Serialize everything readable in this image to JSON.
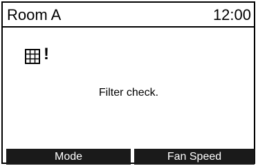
{
  "header": {
    "room_name": "Room A",
    "clock": "12:00"
  },
  "alert": {
    "icon": "filter-icon",
    "mark": "!",
    "message": "Filter check."
  },
  "softkeys": {
    "left_label": "Mode",
    "right_label": "Fan Speed"
  },
  "colors": {
    "foreground": "#000000",
    "background": "#ffffff",
    "softkey_background": "#1a1a1a",
    "softkey_text": "#ffffff"
  }
}
